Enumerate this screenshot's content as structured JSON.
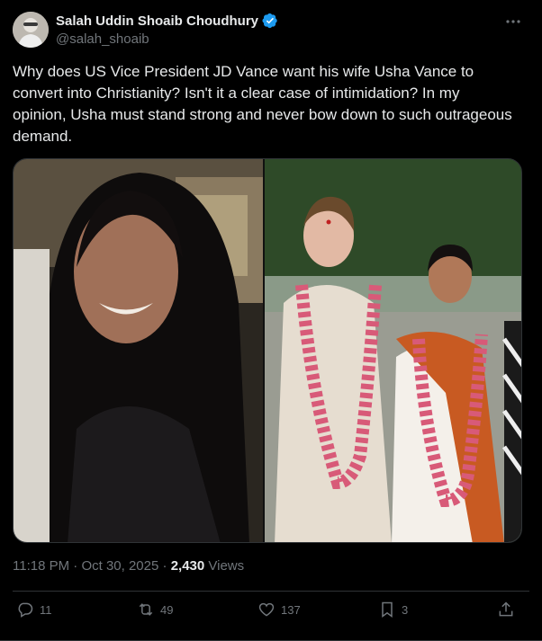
{
  "author": {
    "display_name": "Salah Uddin Shoaib Choudhury",
    "handle": "@salah_shoaib",
    "verified": true
  },
  "tweet": {
    "text": "Why does US Vice President JD Vance want his wife Usha Vance to convert into Christianity? Isn't it a clear case of intimidation? In my opinion, Usha must stand strong and never bow down to such outrageous demand."
  },
  "meta": {
    "time": "11:18 PM",
    "separator1": " · ",
    "date": "Oct 30, 2025",
    "separator2": " · ",
    "views_count": "2,430",
    "views_label": " Views"
  },
  "actions": {
    "reply_count": "11",
    "retweet_count": "49",
    "like_count": "137",
    "bookmark_count": "3"
  },
  "icons": {
    "verified": "verified-badge-icon",
    "more": "more-icon",
    "reply": "reply-icon",
    "retweet": "retweet-icon",
    "like": "heart-icon",
    "bookmark": "bookmark-icon",
    "share": "share-icon"
  },
  "colors": {
    "background": "#000000",
    "text": "#e7e9ea",
    "secondary": "#71767b",
    "verified": "#1d9bf0",
    "border": "#2f3336"
  }
}
